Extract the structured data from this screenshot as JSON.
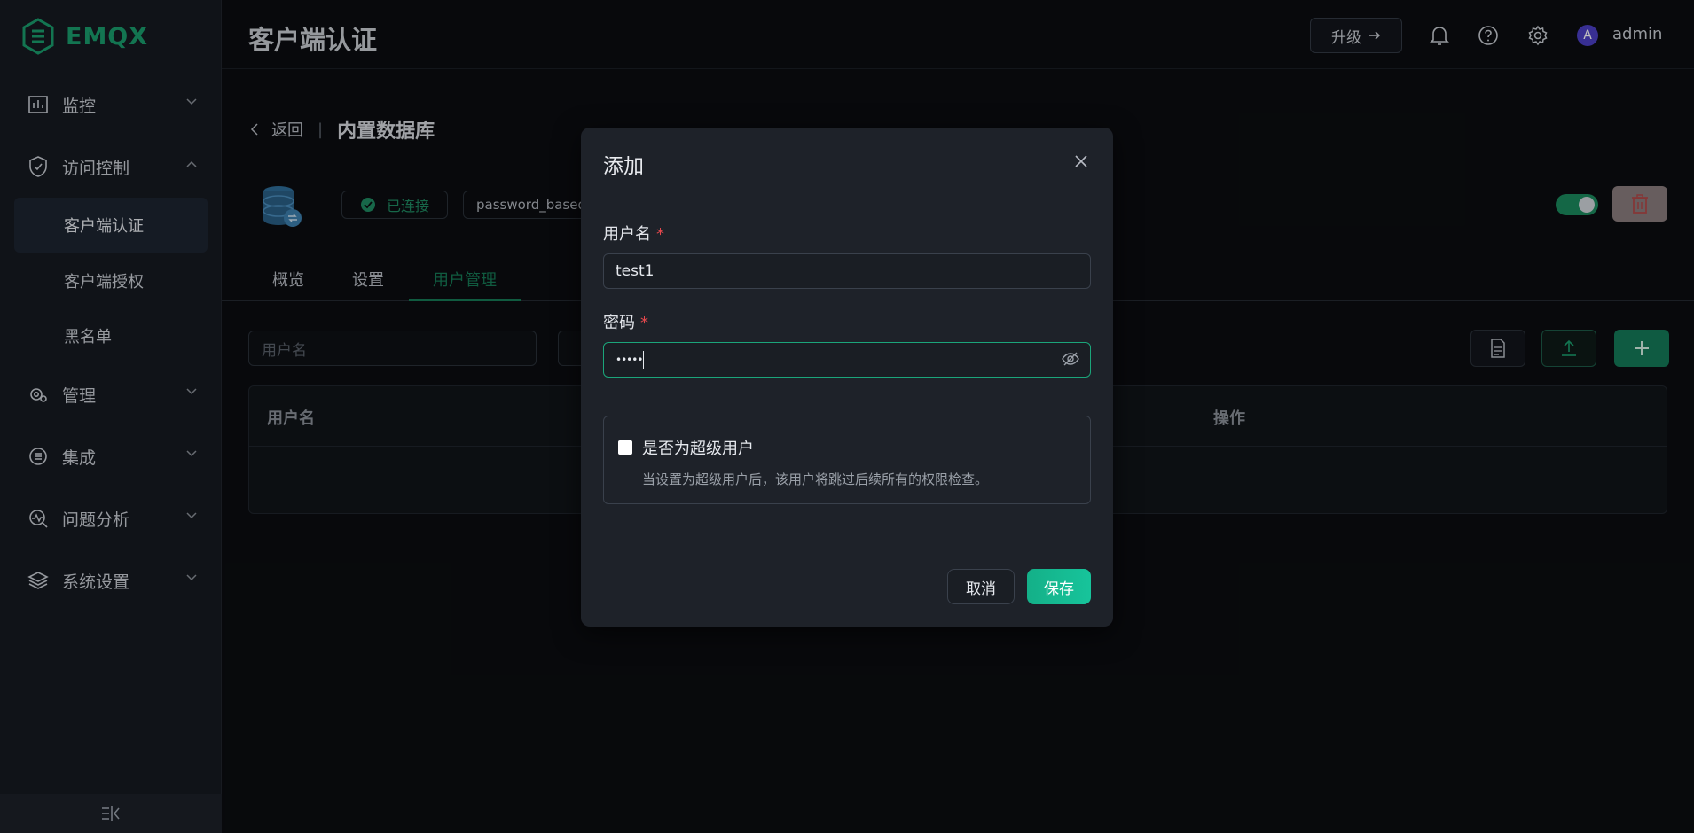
{
  "app": {
    "logo_text": "EMQX",
    "brand_color": "#1a9d6d"
  },
  "sidebar": {
    "items": [
      {
        "label": "监控",
        "icon": "chart-icon"
      },
      {
        "label": "访问控制",
        "icon": "shield-icon"
      },
      {
        "label": "管理",
        "icon": "gear-people-icon"
      },
      {
        "label": "集成",
        "icon": "integration-icon"
      },
      {
        "label": "问题分析",
        "icon": "diagnose-icon"
      },
      {
        "label": "系统设置",
        "icon": "layers-icon"
      }
    ],
    "sub_items": [
      {
        "label": "客户端认证",
        "active": true
      },
      {
        "label": "客户端授权"
      },
      {
        "label": "黑名单"
      }
    ],
    "collapse_icon": "collapse-icon"
  },
  "header": {
    "title": "客户端认证",
    "upgrade_label": "升级",
    "user_initial": "A",
    "user_name": "admin"
  },
  "detail": {
    "back_label": "返回",
    "title": "内置数据库",
    "status": "已连接",
    "mechanism": "password_based",
    "enabled": true
  },
  "tabs": [
    {
      "label": "概览"
    },
    {
      "label": "设置"
    },
    {
      "label": "用户管理",
      "active": true
    }
  ],
  "filters": {
    "username_placeholder": "用户名"
  },
  "table": {
    "headers": [
      "用户名",
      "操作"
    ]
  },
  "dialog": {
    "title": "添加",
    "username_label": "用户名",
    "username_value": "test1",
    "password_label": "密码",
    "password_mask": "•••••",
    "required_mark": "*",
    "superuser_label": "是否为超级用户",
    "superuser_desc": "当设置为超级用户后，该用户将跳过后续所有的权限检查。",
    "superuser_checked": false,
    "cancel_label": "取消",
    "save_label": "保存"
  }
}
